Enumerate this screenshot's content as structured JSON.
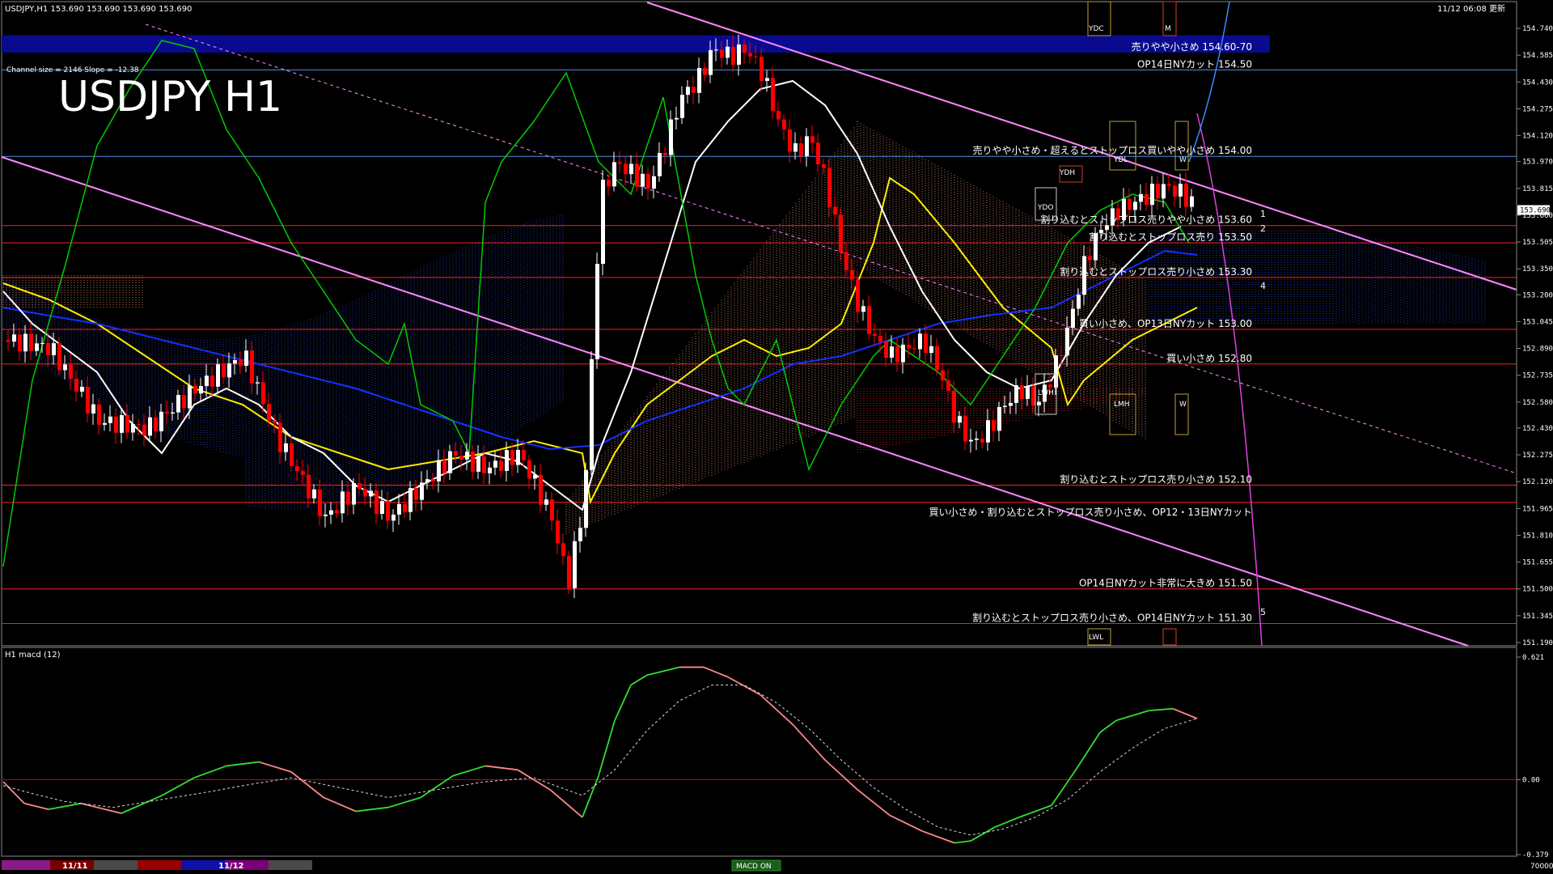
{
  "header": {
    "symbol_info": "USDJPY,H1  153.690 153.690 153.690 153.690",
    "datetime": "11/12 06:08 更新",
    "channel_info": "Channel size = 2146 Slope = -12.38",
    "big_title": "USDJPY H1"
  },
  "price_axis": {
    "ticks": [
      "154.740",
      "154.585",
      "154.430",
      "154.275",
      "154.120",
      "153.970",
      "153.815",
      "153.660",
      "153.505",
      "153.350",
      "153.200",
      "153.045",
      "152.890",
      "152.735",
      "152.580",
      "152.430",
      "152.275",
      "152.120",
      "151.965",
      "151.810",
      "151.655",
      "151.500",
      "151.345",
      "151.190"
    ],
    "current_price": "153.690"
  },
  "levels": [
    {
      "price": 154.6,
      "label": "売りやや小さめ 154.60-70",
      "band": true
    },
    {
      "price": 154.5,
      "label": "OP14日NYカット 154.50"
    },
    {
      "price": 154.0,
      "label": "売りやや小さめ・超えるとストップロス買いやや小さめ 154.00"
    },
    {
      "price": 153.6,
      "label": "割り込むとストップロス売りやや小さめ 153.60"
    },
    {
      "price": 153.5,
      "label": "割り込むとストップロス売り 153.50"
    },
    {
      "price": 153.3,
      "label": "割り込むとストップロス売り小さめ 153.30"
    },
    {
      "price": 153.0,
      "label": "買い小さめ、OP13日NYカット 153.00"
    },
    {
      "price": 152.8,
      "label": "買い小さめ 152.80"
    },
    {
      "price": 152.1,
      "label": "割り込むとストップロス売り小さめ 152.10"
    },
    {
      "price": 152.0,
      "label": "買い小さめ・割り込むとストップロス売り小さめ、OP12・13日NYカット"
    },
    {
      "price": 151.5,
      "label": "OP14日NYカット非常に大きめ 151.50"
    },
    {
      "price": 151.3,
      "label": "割り込むとストップロス売り小さめ、OP14日NYカット 151.30"
    }
  ],
  "markers": {
    "numbers": [
      "1",
      "2",
      "4",
      "5"
    ],
    "boxes": [
      "YDC",
      "YDH",
      "YDO",
      "YDL",
      "LWH",
      "LMH",
      "LWL",
      "W",
      "W",
      "M"
    ]
  },
  "macd": {
    "label": "H1 macd (12)",
    "ticks": [
      "0.621",
      "0.00",
      "-0.379"
    ]
  },
  "time_axis": {
    "labels": [
      "11/11",
      "11/12"
    ],
    "badge": "MACD ON",
    "volume_label": "70000"
  },
  "colors": {
    "background": "#000000",
    "bull_candle": "#ffffff",
    "bear_candle": "#ff0000",
    "level_line": "#ff2020",
    "blue_line": "#4a90e2",
    "channel": "#ff88ff",
    "ma_white": "#ffffff",
    "ma_yellow": "#ffee00",
    "ma_blue": "#1530ff",
    "chikou": "#00cc00",
    "macd_up": "#33dd33",
    "macd_down": "#ff8888",
    "band": "#0a0a8f"
  }
}
